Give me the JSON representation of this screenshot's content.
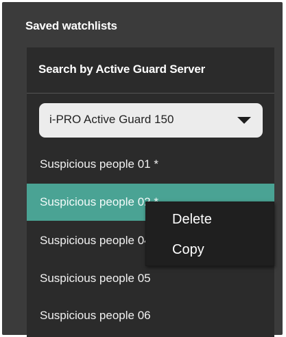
{
  "section": {
    "title": "Saved watchlists"
  },
  "panel": {
    "header": "Search by Active Guard Server",
    "server_select": {
      "value": "i-PRO Active Guard 150"
    },
    "watchlists": [
      {
        "label": "Suspicious people 01 *",
        "selected": false
      },
      {
        "label": "Suspicious people 02 *",
        "selected": true
      },
      {
        "label": "Suspicious people 04",
        "selected": false
      },
      {
        "label": "Suspicious people 05",
        "selected": false
      },
      {
        "label": "Suspicious people 06",
        "selected": false
      }
    ]
  },
  "context_menu": {
    "items": [
      {
        "label": "Delete"
      },
      {
        "label": "Copy"
      }
    ]
  },
  "colors": {
    "background": "#3b3b3b",
    "panel": "#2b2b2b",
    "selection": "#4aa394",
    "menu": "#1f1f1f"
  }
}
